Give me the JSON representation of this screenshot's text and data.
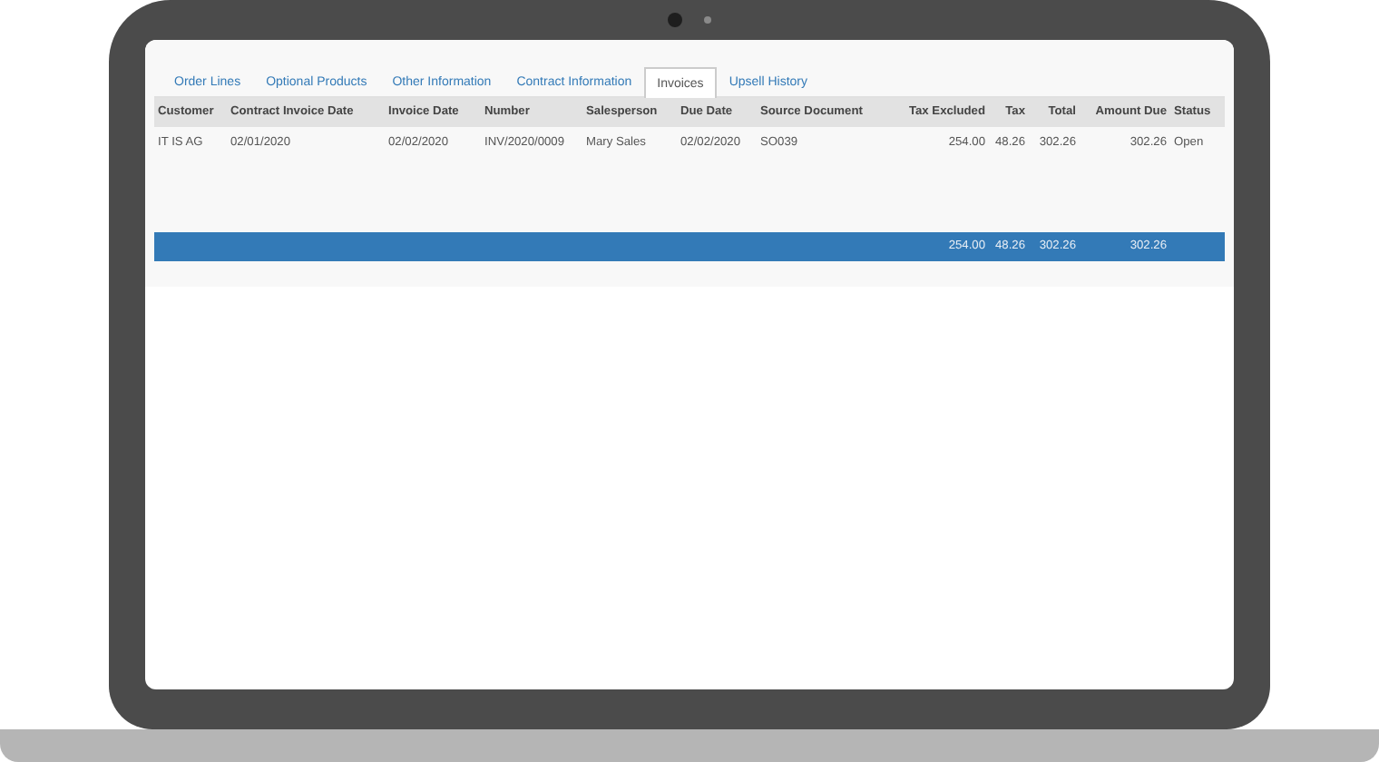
{
  "tabs": [
    {
      "label": "Order Lines",
      "selected": false
    },
    {
      "label": "Optional Products",
      "selected": false
    },
    {
      "label": "Other Information",
      "selected": false
    },
    {
      "label": "Contract Information",
      "selected": false
    },
    {
      "label": "Invoices",
      "selected": true
    },
    {
      "label": "Upsell History",
      "selected": false
    }
  ],
  "table": {
    "columns": [
      {
        "label": "Customer",
        "kind": "text"
      },
      {
        "label": "Contract Invoice Date",
        "kind": "text"
      },
      {
        "label": "Invoice Date",
        "kind": "text"
      },
      {
        "label": "Number",
        "kind": "text"
      },
      {
        "label": "Salesperson",
        "kind": "text"
      },
      {
        "label": "Due Date",
        "kind": "text"
      },
      {
        "label": "Source Document",
        "kind": "text"
      },
      {
        "label": "Tax Excluded",
        "kind": "number",
        "total": "254.00"
      },
      {
        "label": "Tax",
        "kind": "number",
        "total": "48.26"
      },
      {
        "label": "Total",
        "kind": "number",
        "total": "302.26"
      },
      {
        "label": "Amount Due",
        "kind": "number",
        "total": "302.26"
      },
      {
        "label": "Status",
        "kind": "text"
      }
    ],
    "rows": [
      [
        "IT IS AG",
        "02/01/2020",
        "02/02/2020",
        "INV/2020/0009",
        "Mary Sales",
        "02/02/2020",
        "SO039",
        "254.00",
        "48.26",
        "302.26",
        "302.26",
        "Open"
      ]
    ]
  }
}
